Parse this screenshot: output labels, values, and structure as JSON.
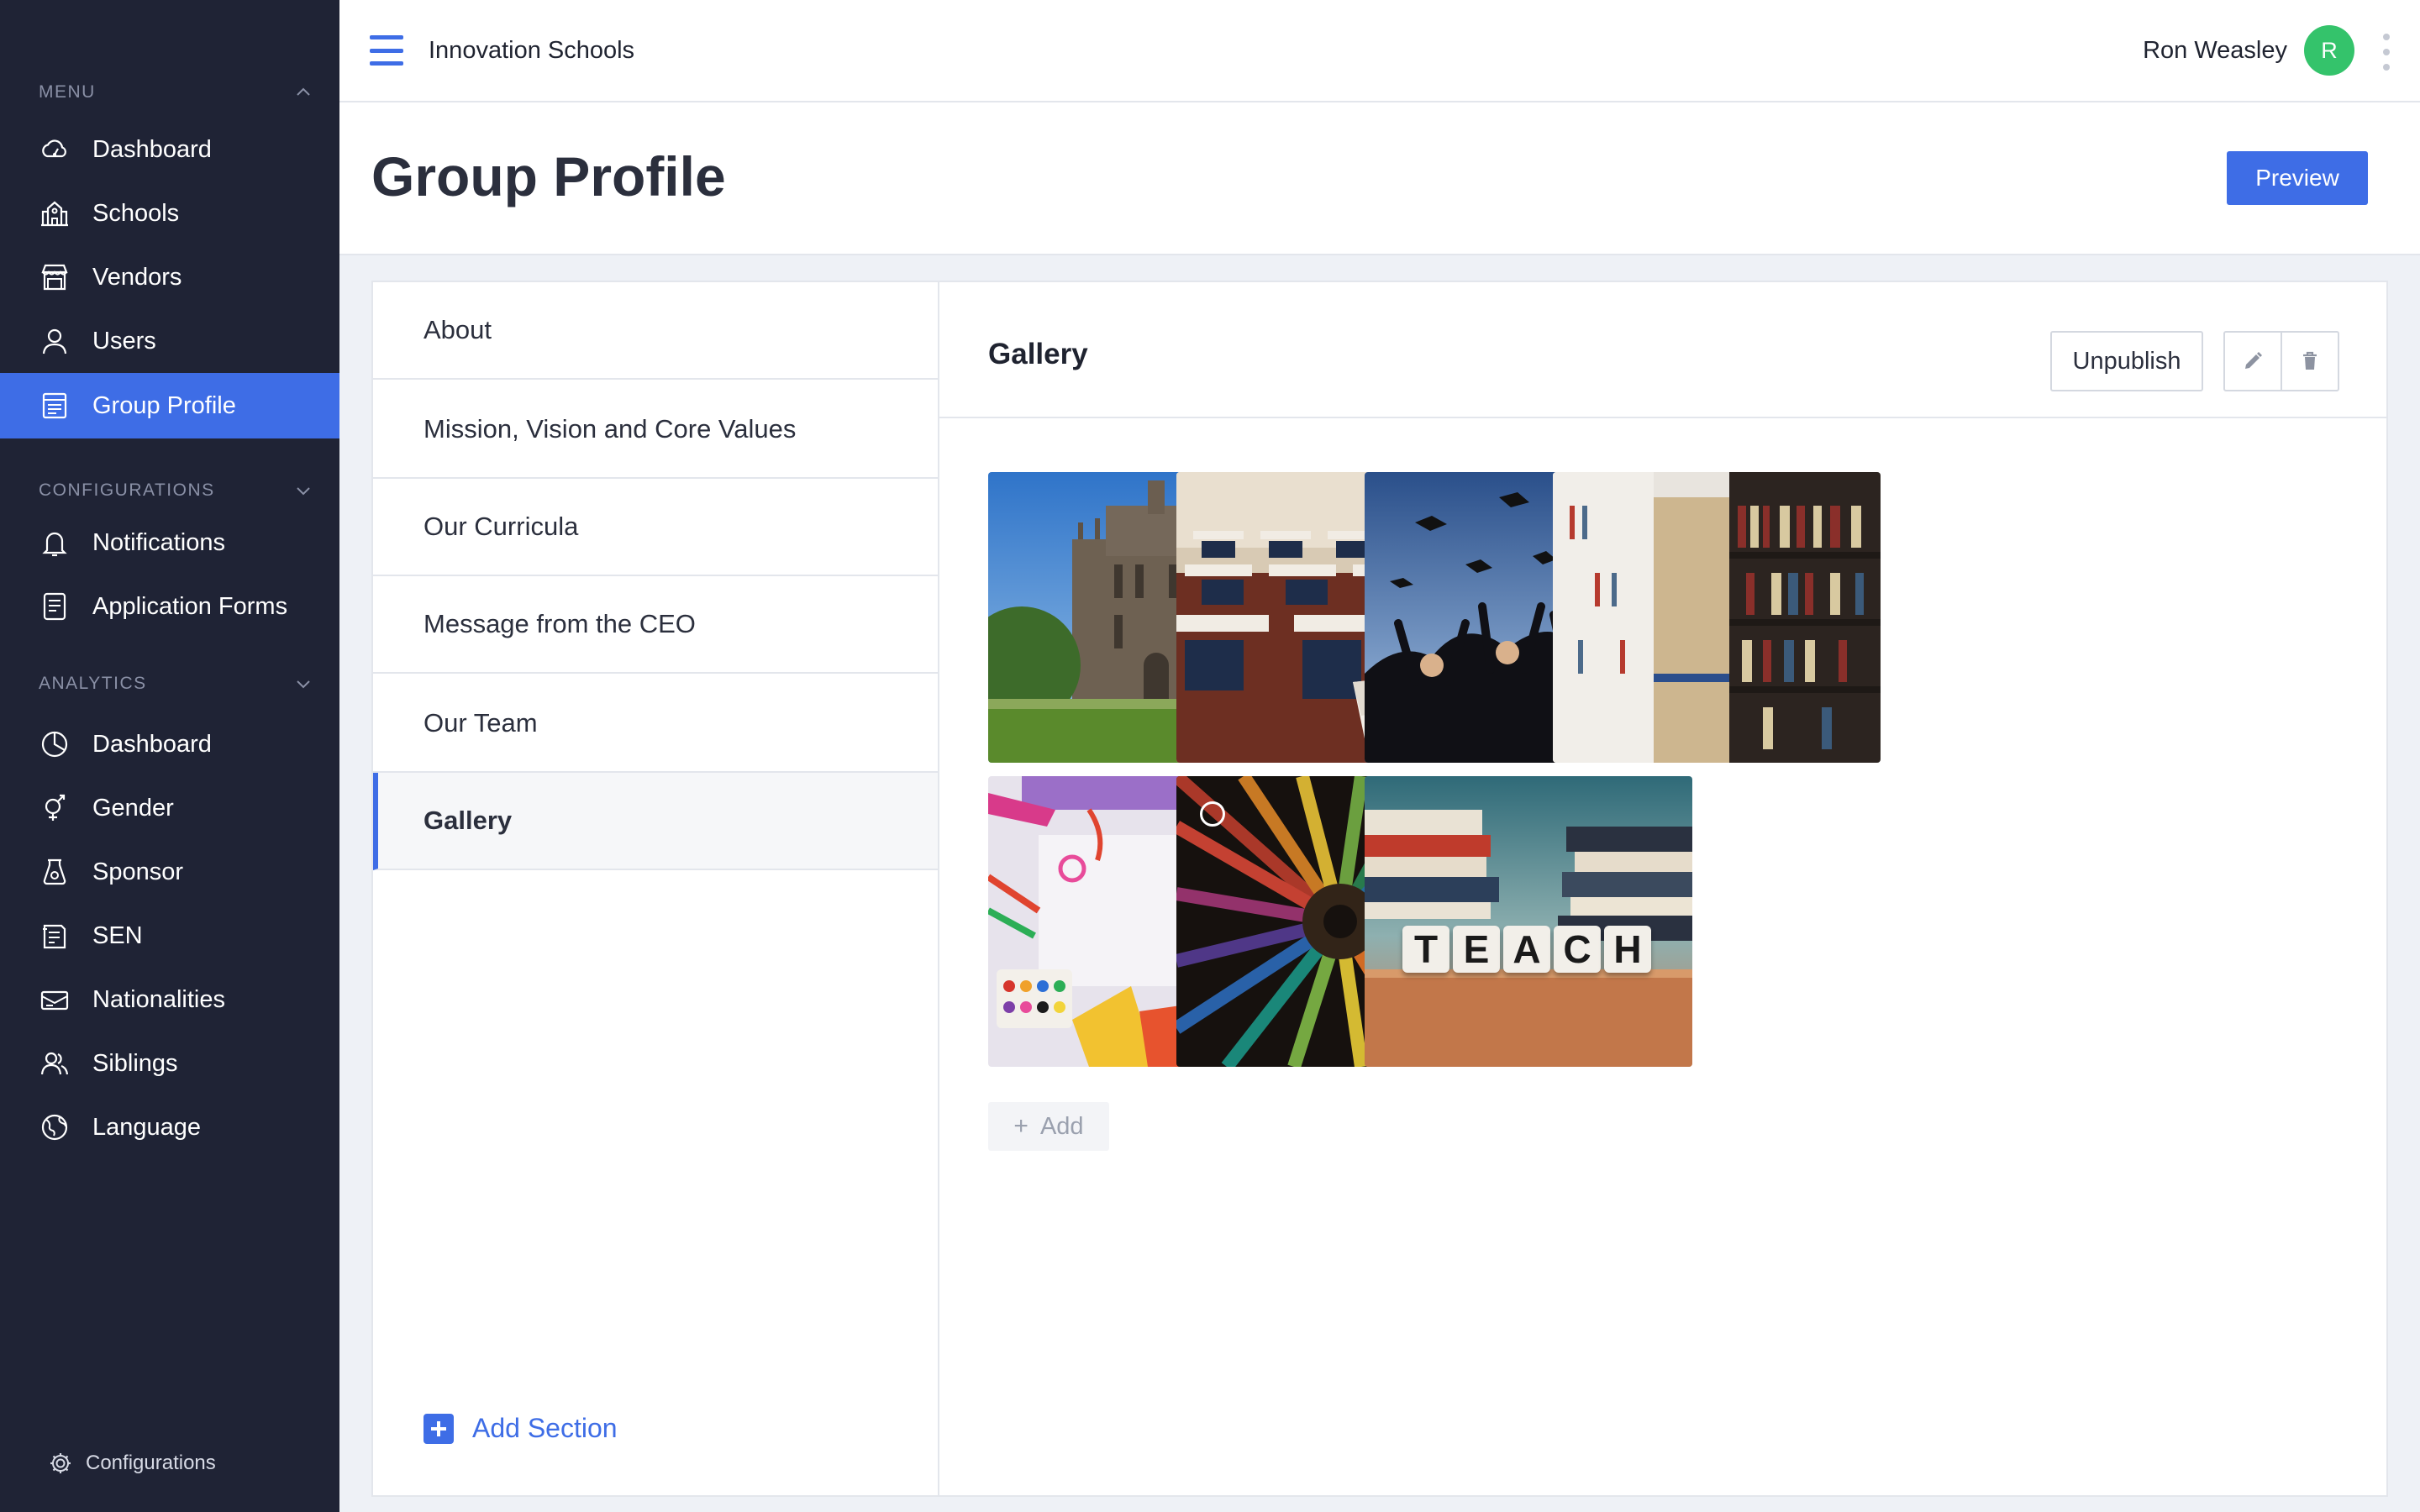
{
  "app": {
    "brand": "Innovation Schools"
  },
  "user": {
    "name": "Ron Weasley",
    "initial": "R",
    "avatar_color": "#34c36b"
  },
  "colors": {
    "accent": "#3e6de6",
    "sidebar_bg": "#1f2335"
  },
  "sidebar": {
    "menu_title": "MENU",
    "menu_items": [
      {
        "label": "Dashboard",
        "icon": "cloud-dashboard-icon"
      },
      {
        "label": "Schools",
        "icon": "school-building-icon"
      },
      {
        "label": "Vendors",
        "icon": "store-icon"
      },
      {
        "label": "Users",
        "icon": "user-icon"
      },
      {
        "label": "Group Profile",
        "icon": "profile-card-icon",
        "active": true
      }
    ],
    "config_title": "CONFIGURATIONS",
    "config_items": [
      {
        "label": "Notifications",
        "icon": "bell-icon"
      },
      {
        "label": "Application Forms",
        "icon": "form-icon"
      }
    ],
    "analytics_title": "ANALYTICS",
    "analytics_items": [
      {
        "label": "Dashboard",
        "icon": "pie-chart-icon"
      },
      {
        "label": "Gender",
        "icon": "gender-icon"
      },
      {
        "label": "Sponsor",
        "icon": "sponsor-icon"
      },
      {
        "label": "SEN",
        "icon": "sen-icon"
      },
      {
        "label": "Nationalities",
        "icon": "passport-icon"
      },
      {
        "label": "Siblings",
        "icon": "siblings-icon"
      },
      {
        "label": "Language",
        "icon": "globe-icon"
      }
    ],
    "footer_label": "Configurations"
  },
  "page": {
    "title": "Group Profile",
    "preview_label": "Preview"
  },
  "sections": {
    "items": [
      {
        "label": "About"
      },
      {
        "label": "Mission, Vision and Core Values"
      },
      {
        "label": "Our Curricula"
      },
      {
        "label": "Message from the CEO"
      },
      {
        "label": "Our Team"
      },
      {
        "label": "Gallery",
        "active": true
      }
    ],
    "add_label": "Add Section"
  },
  "gallery": {
    "title": "Gallery",
    "unpublish_label": "Unpublish",
    "add_label": "Add",
    "photos": [
      {
        "subject": "university-building"
      },
      {
        "subject": "classroom-desks"
      },
      {
        "subject": "graduation-caps"
      },
      {
        "subject": "library-shelves"
      },
      {
        "subject": "art-supplies"
      },
      {
        "subject": "colored-pencils",
        "hovered": true
      },
      {
        "subject": "teach-blocks",
        "letters": "TEACH"
      }
    ]
  }
}
